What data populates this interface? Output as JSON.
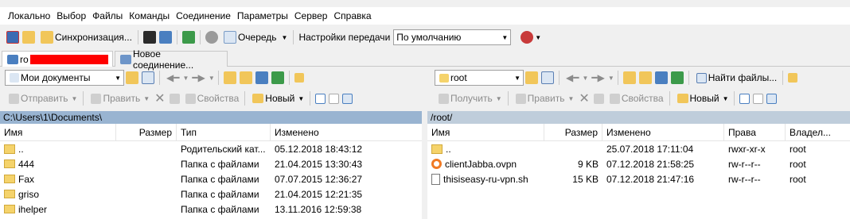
{
  "menu": [
    "Локально",
    "Выбор",
    "Файлы",
    "Команды",
    "Соединение",
    "Параметры",
    "Сервер",
    "Справка"
  ],
  "toolbar": {
    "sync_label": "Синхронизация...",
    "queue_label": "Очередь",
    "transfer_label": "Настройки передачи",
    "transfer_value": "По умолчанию"
  },
  "tabs": {
    "session_label": "ro",
    "new_session_label": "Новое соединение..."
  },
  "left": {
    "location": "Мои документы",
    "actions": {
      "send": "Отправить",
      "edit": "Править",
      "props": "Свойства",
      "new": "Новый"
    },
    "path": "C:\\Users\\1\\Documents\\",
    "columns": [
      "Имя",
      "Размер",
      "Тип",
      "Изменено"
    ],
    "rows": [
      {
        "name": "..",
        "size": "",
        "type": "Родительский кат...",
        "modified": "05.12.2018  18:43:12",
        "icon": "up-icon"
      },
      {
        "name": "444",
        "size": "",
        "type": "Папка с файлами",
        "modified": "21.04.2015  13:30:43",
        "icon": "folder-icon"
      },
      {
        "name": "Fax",
        "size": "",
        "type": "Папка с файлами",
        "modified": "07.07.2015  12:36:27",
        "icon": "folder-icon"
      },
      {
        "name": "griso",
        "size": "",
        "type": "Папка с файлами",
        "modified": "21.04.2015  12:21:35",
        "icon": "folder-icon"
      },
      {
        "name": "ihelper",
        "size": "",
        "type": "Папка с файлами",
        "modified": "13.11.2016  12:59:38",
        "icon": "folder-icon"
      }
    ]
  },
  "right": {
    "location": "root",
    "find_label": "Найти файлы...",
    "actions": {
      "receive": "Получить",
      "edit": "Править",
      "props": "Свойства",
      "new": "Новый"
    },
    "path": "/root/",
    "columns": [
      "Имя",
      "Размер",
      "Изменено",
      "Права",
      "Владел..."
    ],
    "rows": [
      {
        "name": "..",
        "size": "",
        "modified": "25.07.2018  17:11:04",
        "rights": "rwxr-xr-x",
        "owner": "root",
        "icon": "up-icon"
      },
      {
        "name": "clientJabba.ovpn",
        "size": "9 KB",
        "modified": "07.12.2018  21:58:25",
        "rights": "rw-r--r--",
        "owner": "root",
        "icon": "vpn-icon"
      },
      {
        "name": "thisiseasy-ru-vpn.sh",
        "size": "15 KB",
        "modified": "07.12.2018  21:47:16",
        "rights": "rw-r--r--",
        "owner": "root",
        "icon": "file-icon"
      }
    ]
  },
  "colors": {
    "path_left": "#99b4d1",
    "path_right": "#bfcddb",
    "redact": "#ff0000"
  }
}
